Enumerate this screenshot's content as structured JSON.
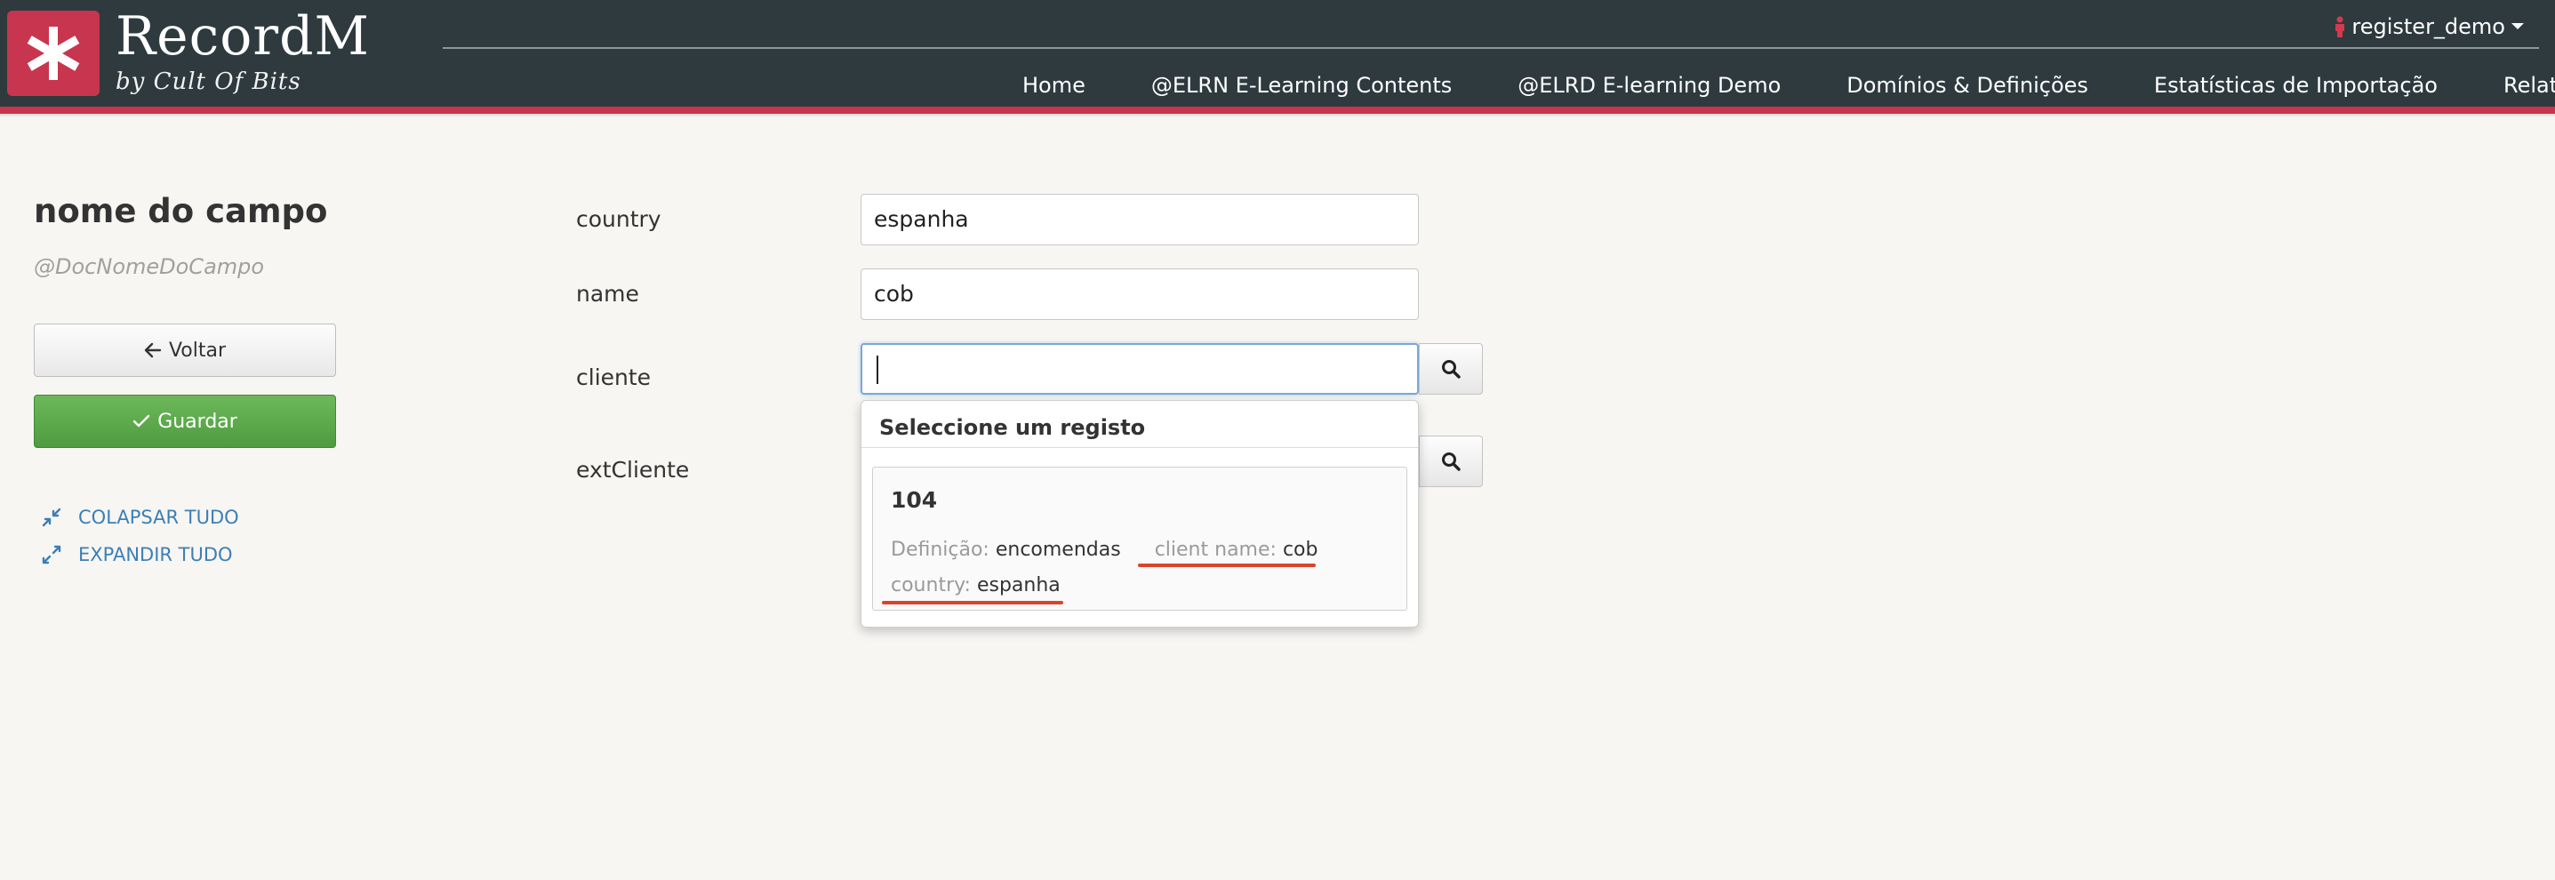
{
  "colors": {
    "header_bg": "#2e3a3e",
    "brand_red": "#c8354e",
    "link_blue": "#3c7fb6",
    "save_green": "#5aab49",
    "annotation_red": "#d9452a"
  },
  "brand": {
    "name": "RecordM",
    "tagline": "by Cult Of Bits",
    "logo_icon": "asterisk-icon"
  },
  "user_menu": {
    "username": "register_demo",
    "icon": "person-icon",
    "caret_icon": "caret-down-icon"
  },
  "nav": {
    "items": [
      {
        "label": "Home"
      },
      {
        "label": "@ELRN E-Learning Contents"
      },
      {
        "label": "@ELRD E-learning Demo"
      },
      {
        "label": "Domínios & Definições"
      },
      {
        "label": "Estatísticas de Importação"
      },
      {
        "label": "Relatórios"
      }
    ]
  },
  "sidebar": {
    "title": "nome do campo",
    "subtitle": "@DocNomeDoCampo",
    "back_label": "Voltar",
    "back_icon": "arrow-left-icon",
    "save_label": "Guardar",
    "save_icon": "check-icon",
    "collapse_label": "COLAPSAR TUDO",
    "collapse_icon": "compress-icon",
    "expand_label": "EXPANDIR TUDO",
    "expand_icon": "expand-icon"
  },
  "form": {
    "fields": [
      {
        "label": "country",
        "value": "espanha"
      },
      {
        "label": "name",
        "value": "cob"
      },
      {
        "label": "cliente",
        "value": ""
      },
      {
        "label": "extCliente",
        "value": ""
      }
    ],
    "search_icon": "search-icon"
  },
  "dropdown": {
    "header": "Seleccione um registo",
    "result": {
      "id": "104",
      "definition_key": "Definição:",
      "definition_value": "encomendas",
      "client_name_key": "client name:",
      "client_name_value": "cob",
      "country_key": "country:",
      "country_value": "espanha"
    }
  }
}
